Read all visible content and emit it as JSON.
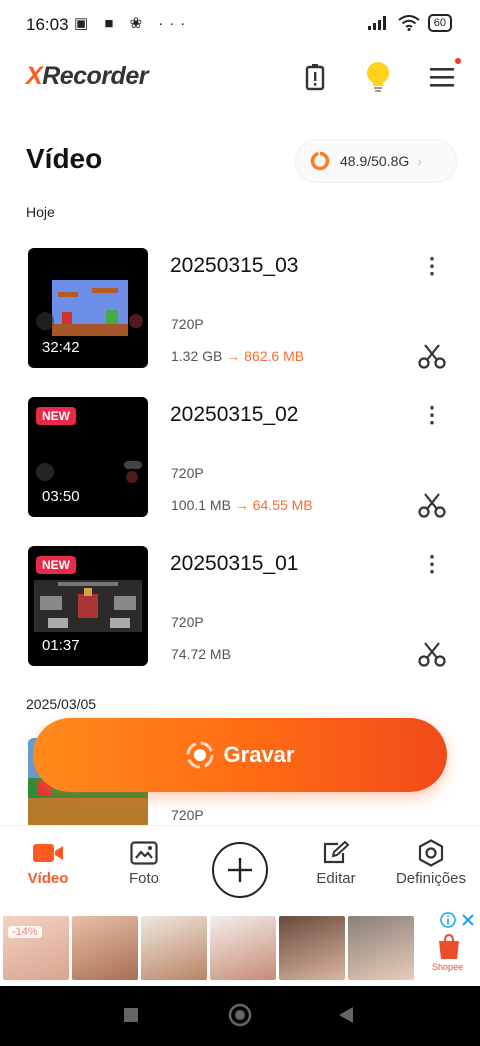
{
  "status": {
    "time": "16:03",
    "left_icons": "▣ ■ ❀ ···",
    "battery": "60"
  },
  "header": {
    "logo_x": "X",
    "logo_rest": "Recorder"
  },
  "page": {
    "title": "Vídeo",
    "storage": "48.9/50.8G"
  },
  "sections": {
    "today": "Hoje",
    "earlier": "2025/03/05"
  },
  "videos": [
    {
      "name": "20250315_03",
      "resolution": "720P",
      "duration": "32:42",
      "size": "1.32 GB",
      "arrow": "→",
      "compressed": "862.6 MB",
      "badge": ""
    },
    {
      "name": "20250315_02",
      "resolution": "720P",
      "duration": "03:50",
      "size": "100.1 MB",
      "arrow": "→",
      "compressed": "64.55 MB",
      "badge": "NEW"
    },
    {
      "name": "20250315_01",
      "resolution": "720P",
      "duration": "01:37",
      "size": "74.72 MB",
      "arrow": "",
      "compressed": "",
      "badge": "NEW"
    },
    {
      "name": "",
      "resolution": "720P",
      "duration": "",
      "size": "",
      "arrow": "",
      "compressed": "",
      "badge": ""
    }
  ],
  "record": {
    "label": "Gravar"
  },
  "nav": {
    "video": "Vídeo",
    "foto": "Foto",
    "editar": "Editar",
    "definicoes": "Definições"
  },
  "ad": {
    "discount": "-14%",
    "brand": "Shopee"
  },
  "colors": {
    "accent": "#ff5a1f",
    "badge": "#e8294a"
  }
}
